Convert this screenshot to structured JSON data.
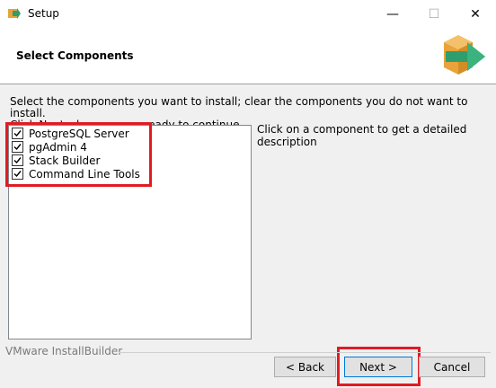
{
  "window": {
    "title": "Setup",
    "min_glyph": "—",
    "max_glyph": "☐",
    "close_glyph": "✕"
  },
  "header": {
    "title": "Select Components",
    "logo_icon": "installer-box-arrow-icon"
  },
  "instructions": {
    "line1": "Select the components you want to install; clear the components you do not want to install.",
    "line2": "Click Next when you are ready to continue."
  },
  "components": [
    {
      "label": "PostgreSQL Server",
      "checked": true
    },
    {
      "label": "pgAdmin 4",
      "checked": true
    },
    {
      "label": "Stack Builder",
      "checked": true
    },
    {
      "label": "Command Line Tools",
      "checked": true
    }
  ],
  "description": {
    "text": "Click on a component to get a detailed description"
  },
  "footer": {
    "brand": "VMware InstallBuilder",
    "back_label": "< Back",
    "next_label": "Next >",
    "cancel_label": "Cancel"
  },
  "colors": {
    "highlight": "#e21b23",
    "logo_orange": "#e8a33a",
    "logo_green": "#2e9e6e"
  }
}
